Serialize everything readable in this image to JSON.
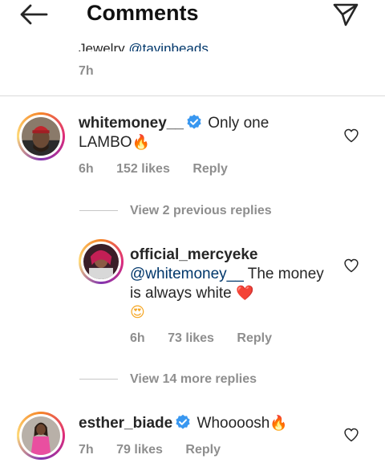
{
  "header": {
    "title": "Comments",
    "back_icon": "arrow-left-icon",
    "send_icon": "paper-plane-icon"
  },
  "previous_comment": {
    "text_prefix": "Jewelry ",
    "mention": "@tavinbeads",
    "time": "7h"
  },
  "comments": [
    {
      "username": "whitemoney__",
      "verified": true,
      "text": "Only one LAMBO",
      "emoji": "🔥",
      "time": "6h",
      "likes": "152 likes",
      "reply_label": "Reply",
      "view_replies": "View 2 previous replies",
      "replies": [
        {
          "username": "official_mercyeke",
          "verified": false,
          "mention": "@whitemoney__",
          "text": "The money is always white",
          "emoji_heart": "❤️",
          "emoji_face": "😍",
          "time": "6h",
          "likes": "73 likes",
          "reply_label": "Reply"
        }
      ],
      "view_more_replies": "View 14 more replies"
    },
    {
      "username": "esther_biade",
      "verified": true,
      "text": "Whoooosh",
      "emoji": "🔥",
      "time": "7h",
      "likes": "79 likes",
      "reply_label": "Reply"
    }
  ],
  "colors": {
    "text": "#262626",
    "secondary": "#8e8e8e",
    "mention": "#00376b",
    "verified": "#3897f0"
  }
}
